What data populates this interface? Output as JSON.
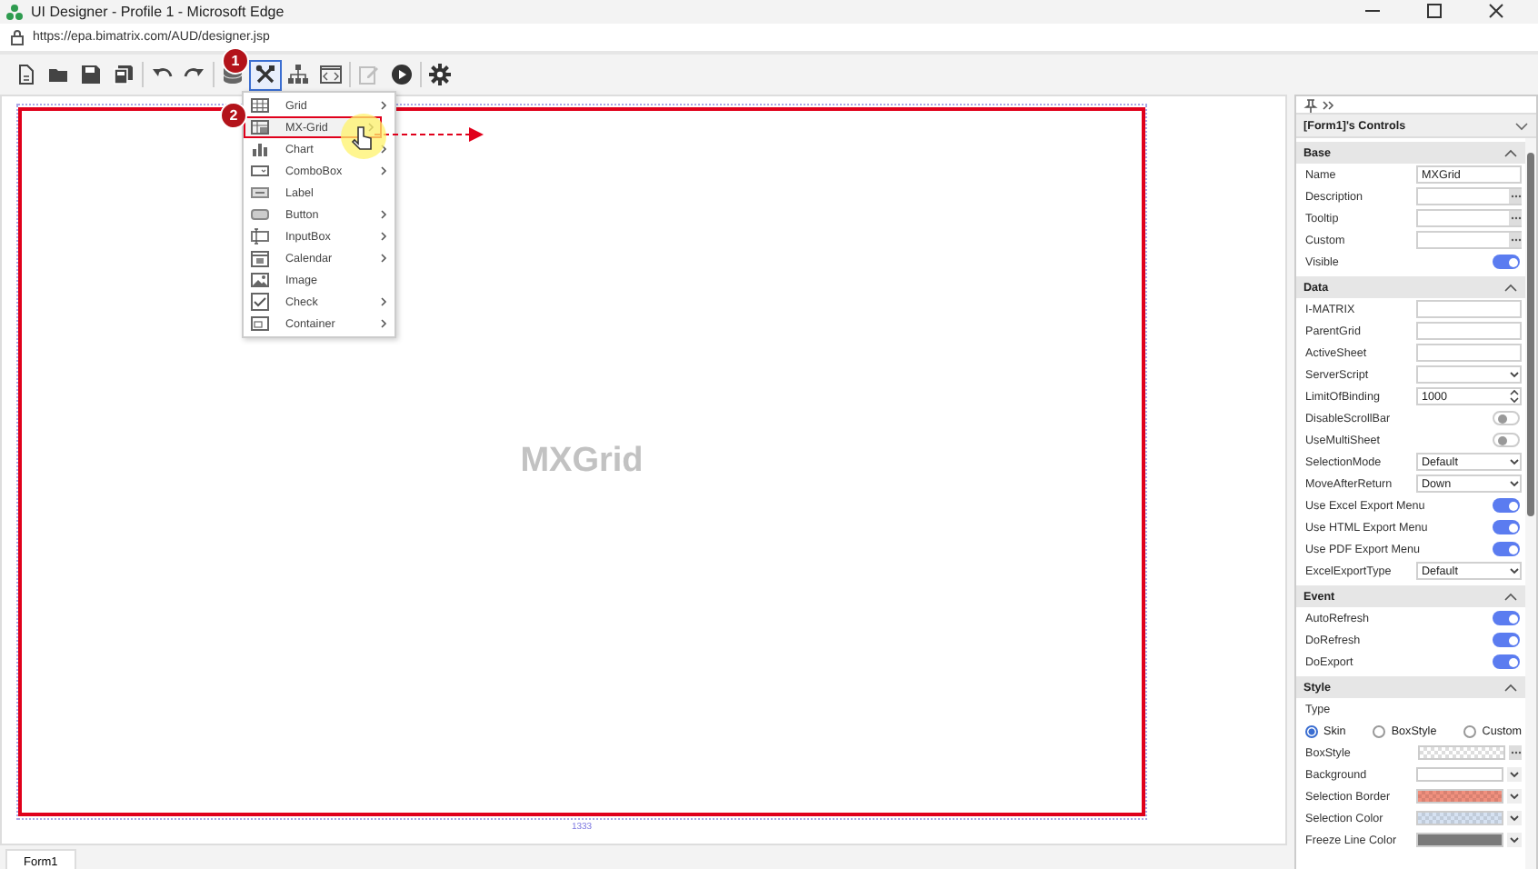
{
  "window": {
    "title": "UI Designer - Profile 1 - Microsoft Edge"
  },
  "address_bar": {
    "url": "https://epa.bimatrix.com/AUD/designer.jsp"
  },
  "toolbar": [
    {
      "kind": "new",
      "selected": false,
      "disabled": false
    },
    {
      "kind": "open",
      "selected": false,
      "disabled": false
    },
    {
      "kind": "save",
      "selected": false,
      "disabled": false
    },
    {
      "kind": "save-all",
      "selected": false,
      "disabled": false
    },
    {
      "kind": "separator"
    },
    {
      "kind": "undo",
      "selected": false,
      "disabled": false
    },
    {
      "kind": "redo",
      "selected": false,
      "disabled": false
    },
    {
      "kind": "separator"
    },
    {
      "kind": "database",
      "selected": false,
      "disabled": false
    },
    {
      "kind": "tools",
      "selected": true,
      "disabled": false
    },
    {
      "kind": "hierarchy",
      "selected": false,
      "disabled": false
    },
    {
      "kind": "code",
      "selected": false,
      "disabled": false
    },
    {
      "kind": "separator"
    },
    {
      "kind": "edit",
      "selected": false,
      "disabled": true
    },
    {
      "kind": "play",
      "selected": false,
      "disabled": false
    },
    {
      "kind": "separator"
    },
    {
      "kind": "settings",
      "selected": false,
      "disabled": false
    }
  ],
  "context_menu": [
    {
      "label": "Grid",
      "has_submenu": true,
      "highlighted": false
    },
    {
      "label": "MX-Grid",
      "has_submenu": true,
      "highlighted": true
    },
    {
      "label": "Chart",
      "has_submenu": true,
      "highlighted": false
    },
    {
      "label": "ComboBox",
      "has_submenu": true,
      "highlighted": false
    },
    {
      "label": "Label",
      "has_submenu": false,
      "highlighted": false
    },
    {
      "label": "Button",
      "has_submenu": true,
      "highlighted": false
    },
    {
      "label": "InputBox",
      "has_submenu": true,
      "highlighted": false
    },
    {
      "label": "Calendar",
      "has_submenu": true,
      "highlighted": false
    },
    {
      "label": "Image",
      "has_submenu": false,
      "highlighted": false
    },
    {
      "label": "Check",
      "has_submenu": true,
      "highlighted": false
    },
    {
      "label": "Container",
      "has_submenu": true,
      "highlighted": false
    }
  ],
  "step_badges": [
    {
      "label": "1"
    },
    {
      "label": "2"
    }
  ],
  "canvas": {
    "component_label": "MXGrid",
    "ruler_label": "1333"
  },
  "form_tabs": [
    {
      "label": "Form1",
      "selected": true
    }
  ],
  "properties_panel": {
    "title": "[Form1]'s Controls",
    "sections": [
      {
        "title": "Base",
        "expanded": true,
        "rows": [
          {
            "kind": "text",
            "label": "Name",
            "value": "MXGrid"
          },
          {
            "kind": "ellipsis",
            "label": "Description"
          },
          {
            "kind": "ellipsis",
            "label": "Tooltip"
          },
          {
            "kind": "ellipsis",
            "label": "Custom"
          },
          {
            "kind": "toggle",
            "label": "Visible",
            "on": true
          }
        ]
      },
      {
        "title": "Data",
        "expanded": true,
        "rows": [
          {
            "kind": "text",
            "label": "I-MATRIX"
          },
          {
            "kind": "text",
            "label": "ParentGrid"
          },
          {
            "kind": "text",
            "label": "ActiveSheet"
          },
          {
            "kind": "select",
            "label": "ServerScript"
          },
          {
            "kind": "spinner",
            "label": "LimitOfBinding",
            "value": "1000"
          },
          {
            "kind": "toggle",
            "label": "DisableScrollBar",
            "on": false
          },
          {
            "kind": "toggle",
            "label": "UseMultiSheet",
            "on": false
          },
          {
            "kind": "select",
            "label": "SelectionMode",
            "value": "Default"
          },
          {
            "kind": "select",
            "label": "MoveAfterReturn",
            "value": "Down"
          },
          {
            "kind": "toggle",
            "label": "Use Excel Export Menu",
            "on": true
          },
          {
            "kind": "toggle",
            "label": "Use HTML Export Menu",
            "on": true
          },
          {
            "kind": "toggle",
            "label": "Use PDF Export Menu",
            "on": true
          },
          {
            "kind": "select",
            "label": "ExcelExportType",
            "value": "Default"
          }
        ]
      },
      {
        "title": "Event",
        "expanded": true,
        "rows": [
          {
            "kind": "toggle",
            "label": "AutoRefresh",
            "on": true
          },
          {
            "kind": "toggle",
            "label": "DoRefresh",
            "on": true
          },
          {
            "kind": "toggle",
            "label": "DoExport",
            "on": true
          }
        ]
      },
      {
        "title": "Style",
        "expanded": true,
        "rows": [
          {
            "kind": "label",
            "label": "Type"
          },
          {
            "kind": "radio",
            "options": [
              {
                "label": "Skin",
                "selected": true
              },
              {
                "label": "BoxStyle",
                "selected": false
              },
              {
                "label": "Custom",
                "selected": false
              }
            ]
          },
          {
            "kind": "pattern",
            "label": "BoxStyle"
          },
          {
            "kind": "color",
            "label": "Background",
            "color": "#ffffff",
            "checkered": false
          },
          {
            "kind": "color",
            "label": "Selection Border",
            "color": "#f0907e",
            "checkered": true
          },
          {
            "kind": "color",
            "label": "Selection Color",
            "color": "#d6e2f2",
            "checkered": true
          },
          {
            "kind": "color",
            "label": "Freeze Line Color",
            "color": "#7a7a7a",
            "checkered": false
          }
        ]
      }
    ]
  }
}
